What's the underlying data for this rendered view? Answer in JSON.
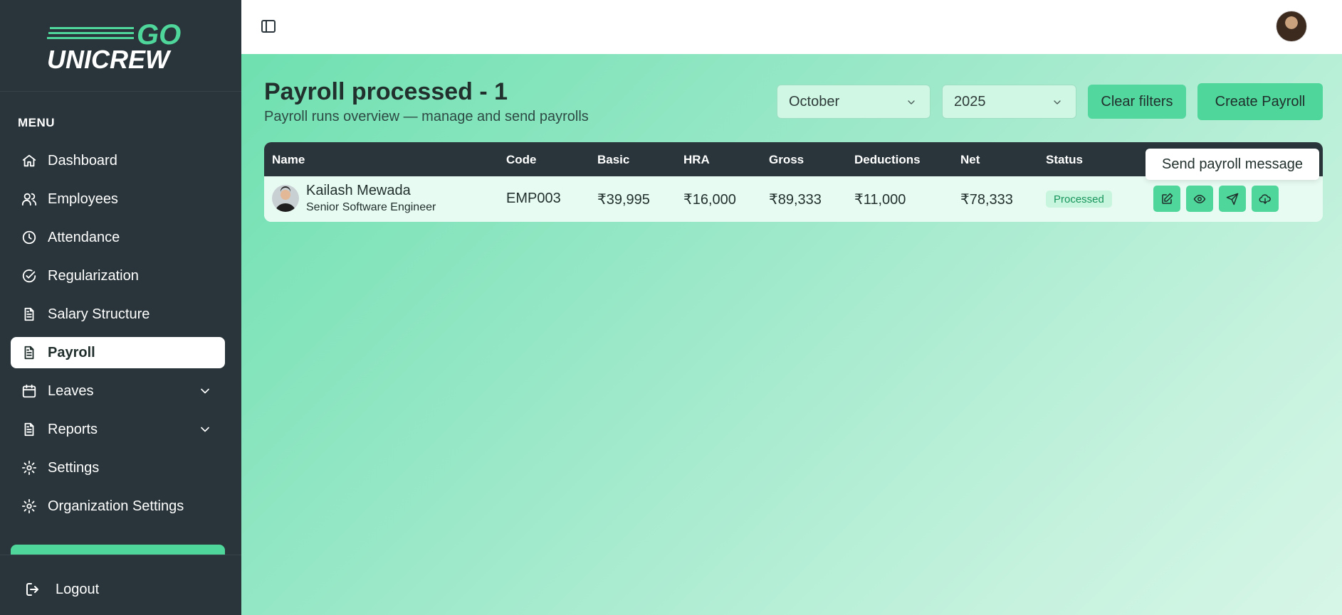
{
  "brand": {
    "logo_top": "GO",
    "logo_bottom": "UNICREW"
  },
  "sidebar": {
    "menu_title": "MENU",
    "items": [
      {
        "label": "Dashboard",
        "icon": "home-icon"
      },
      {
        "label": "Employees",
        "icon": "users-icon"
      },
      {
        "label": "Attendance",
        "icon": "clock-icon"
      },
      {
        "label": "Regularization",
        "icon": "check-circle-icon"
      },
      {
        "label": "Salary Structure",
        "icon": "document-icon"
      },
      {
        "label": "Payroll",
        "icon": "document-icon",
        "active": true
      },
      {
        "label": "Leaves",
        "icon": "calendar-icon",
        "expandable": true
      },
      {
        "label": "Reports",
        "icon": "document-icon",
        "expandable": true
      },
      {
        "label": "Settings",
        "icon": "gear-icon"
      },
      {
        "label": "Organization Settings",
        "icon": "gear-icon"
      }
    ],
    "logout_label": "Logout"
  },
  "header": {
    "title": "Payroll processed - 1",
    "subtitle": "Payroll runs overview — manage and send payrolls"
  },
  "filters": {
    "month": "October",
    "year": "2025",
    "clear_label": "Clear filters",
    "create_label": "Create Payroll"
  },
  "table": {
    "columns": [
      "Name",
      "Code",
      "Basic",
      "HRA",
      "Gross",
      "Deductions",
      "Net",
      "Status"
    ],
    "rows": [
      {
        "name": "Kailash Mewada",
        "role": "Senior Software Engineer",
        "code": "EMP003",
        "basic": "₹39,995",
        "hra": "₹16,000",
        "gross": "₹89,333",
        "deductions": "₹11,000",
        "net": "₹78,333",
        "status": "Processed"
      }
    ]
  },
  "tooltip": "Send payroll message",
  "colors": {
    "accent": "#4fd69a",
    "sidebar_bg": "#29353a",
    "status_text": "#17955c"
  }
}
